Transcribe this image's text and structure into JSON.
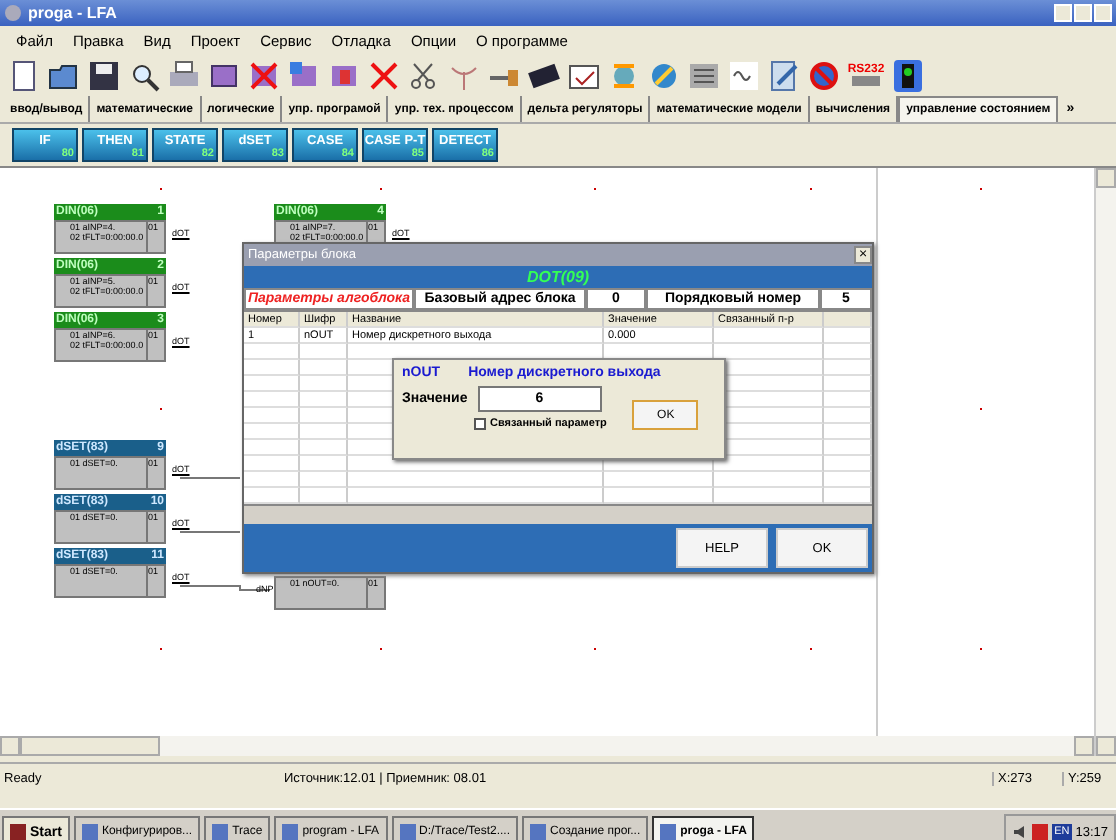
{
  "window": {
    "title": "proga - LFA"
  },
  "menu": [
    "Файл",
    "Правка",
    "Вид",
    "Проект",
    "Сервис",
    "Отладка",
    "Опции",
    "О программе"
  ],
  "rs232_label": "RS232",
  "tabs": [
    {
      "label": "ввод/вывод",
      "selected": false
    },
    {
      "label": "математические",
      "selected": false
    },
    {
      "label": "логические",
      "selected": false
    },
    {
      "label": "упр. програмой",
      "selected": false
    },
    {
      "label": "упр. тех. процессом",
      "selected": false
    },
    {
      "label": "дельта регуляторы",
      "selected": false
    },
    {
      "label": "математические модели",
      "selected": false
    },
    {
      "label": "вычисления",
      "selected": false
    },
    {
      "label": "управление состоянием",
      "selected": true
    }
  ],
  "tab_overflow": "»",
  "blocks": [
    {
      "label": "IF",
      "code": "80"
    },
    {
      "label": "THEN",
      "code": "81"
    },
    {
      "label": "STATE",
      "code": "82"
    },
    {
      "label": "dSET",
      "code": "83"
    },
    {
      "label": "CASE",
      "code": "84"
    },
    {
      "label": "CASE P-T",
      "code": "85"
    },
    {
      "label": "DETECT",
      "code": "86"
    }
  ],
  "canvas": {
    "nodes": [
      {
        "kind": "din",
        "title": "DIN(06)",
        "number": "1",
        "params": [
          "01 aINP=4.",
          "02 tFLT=0:00:00.0"
        ],
        "port": "01",
        "output": "dOT"
      },
      {
        "kind": "din",
        "title": "DIN(06)",
        "number": "2",
        "params": [
          "01 aINP=5.",
          "02 tFLT=0:00:00.0"
        ],
        "port": "01",
        "output": "dOT"
      },
      {
        "kind": "din",
        "title": "DIN(06)",
        "number": "3",
        "params": [
          "01 aINP=6.",
          "02 tFLT=0:00:00.0"
        ],
        "port": "01",
        "output": "dOT"
      },
      {
        "kind": "din",
        "title": "DIN(06)",
        "number": "4",
        "params": [
          "01 aINP=7.",
          "02 tFLT=0:00:00.0"
        ],
        "port": "01",
        "output": "dOT"
      },
      {
        "kind": "dset",
        "title": "dSET(83)",
        "number": "9",
        "params": [
          "01 dSET=0."
        ],
        "port": "01",
        "output": "dOT"
      },
      {
        "kind": "dset",
        "title": "dSET(83)",
        "number": "10",
        "params": [
          "01 dSET=0."
        ],
        "port": "01",
        "output": "dOT"
      },
      {
        "kind": "dset",
        "title": "dSET(83)",
        "number": "11",
        "params": [
          "01 dSET=0."
        ],
        "port": "01",
        "output": "dOT"
      },
      {
        "kind": "dot",
        "input": "dNP",
        "port": "01",
        "params": [
          "01 nOUT=0."
        ]
      }
    ]
  },
  "dialog": {
    "title": "Параметры блока",
    "close": "×",
    "block_name": "DOT(09)",
    "params_label": "Параметры алгоблока",
    "base_address_label": "Базовый адрес блока",
    "base_address": "0",
    "order_label": "Порядковый номер",
    "order": "5",
    "columns": [
      "Номер",
      "Шифр",
      "Название",
      "Значение",
      "Связанный п-р"
    ],
    "rows": [
      [
        "1",
        "nOUT",
        "Номер дискретного выхода",
        "0.000"
      ]
    ],
    "buttons": [
      "HELP",
      "OK"
    ],
    "editor": {
      "code": "nOUT",
      "name": "Номер дискретного выхода",
      "value_label": "Значение",
      "value": "6",
      "linked_label": "Связанный параметр",
      "linked": false,
      "ok": "OK"
    }
  },
  "status_bar": {
    "message": "Ready",
    "link": "Источник:12.01 | Приемник: 08.01",
    "x": "X:273",
    "y": "Y:259"
  },
  "taskbar": {
    "start": "Start",
    "items": [
      {
        "label": "Конфигуриров...",
        "selected": false
      },
      {
        "label": "Trace",
        "selected": false
      },
      {
        "label": "program - LFA",
        "selected": false
      },
      {
        "label": "D:/Trace/Test2....",
        "selected": false
      },
      {
        "label": "Создание прог...",
        "selected": false
      },
      {
        "label": "proga - LFA",
        "selected": true
      }
    ],
    "language": "EN",
    "clock": "13:17"
  }
}
